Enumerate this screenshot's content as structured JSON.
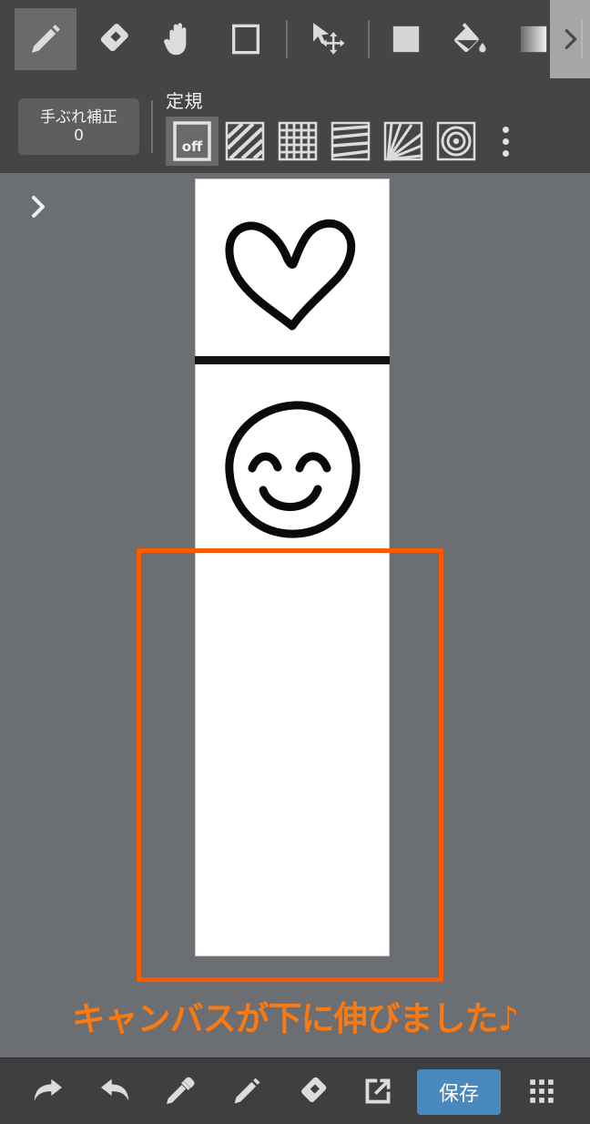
{
  "app": {
    "background_color": "#6b6e72",
    "toolbar_color": "#454545",
    "accent_color": "#fa5a00",
    "save_button_color": "#4a89bd"
  },
  "top_toolbar": {
    "tools": [
      {
        "name": "pencil-tool",
        "icon": "pencil-icon",
        "selected": true
      },
      {
        "name": "eraser-tool",
        "icon": "eraser-icon",
        "selected": false
      },
      {
        "name": "hand-tool",
        "icon": "hand-icon",
        "selected": false
      },
      {
        "name": "select-rect-tool",
        "icon": "rectangle-outline-icon",
        "selected": false
      },
      {
        "name": "move-transform-tool",
        "icon": "move-cursor-icon",
        "selected": false
      },
      {
        "name": "fill-color-tool",
        "icon": "filled-square-icon",
        "selected": false
      },
      {
        "name": "paint-bucket-tool",
        "icon": "paint-bucket-icon",
        "selected": false
      },
      {
        "name": "gradient-tool",
        "icon": "gradient-swatch-icon",
        "selected": false
      }
    ],
    "scroll_right": {
      "name": "scroll-right-button",
      "icon": "chevron-right-icon"
    }
  },
  "options_toolbar": {
    "stabilizer": {
      "label": "手ぶれ補正",
      "value": "0"
    },
    "ruler": {
      "label": "定規",
      "items": [
        {
          "name": "ruler-off",
          "icon": "ruler-off-icon",
          "label": "off",
          "selected": true
        },
        {
          "name": "ruler-parallel",
          "icon": "ruler-parallel-lines-icon",
          "selected": false
        },
        {
          "name": "ruler-grid",
          "icon": "ruler-grid-icon",
          "selected": false
        },
        {
          "name": "ruler-perspective",
          "icon": "ruler-perspective-icon",
          "selected": false
        },
        {
          "name": "ruler-radial",
          "icon": "ruler-radial-icon",
          "selected": false
        },
        {
          "name": "ruler-concentric",
          "icon": "ruler-concentric-circles-icon",
          "selected": false
        }
      ],
      "more_label": "more-options"
    }
  },
  "canvas": {
    "layer_panel_toggle_icon": "chevron-right-icon",
    "sheet_color": "#ffffff",
    "artwork": [
      {
        "name": "heart-drawing",
        "description": "hand-drawn heart outline"
      },
      {
        "name": "divider-line",
        "description": "thick black horizontal line"
      },
      {
        "name": "smiley-face-drawing",
        "description": "hand-drawn smiling face"
      }
    ],
    "selection_rect": {
      "name": "canvas-extend-selection",
      "color": "#fa5a00"
    },
    "message": "キャンバスが下に伸びました♪"
  },
  "bottom_toolbar": {
    "items": [
      {
        "name": "undo-button",
        "icon": "undo-arrow-icon"
      },
      {
        "name": "redo-button",
        "icon": "redo-arrow-icon"
      },
      {
        "name": "eyedropper-button",
        "icon": "eyedropper-icon"
      },
      {
        "name": "pencil-button",
        "icon": "pencil-icon"
      },
      {
        "name": "eraser-button",
        "icon": "eraser-icon"
      },
      {
        "name": "export-button",
        "icon": "export-external-link-icon"
      }
    ],
    "save_label": "保存",
    "menu": {
      "name": "app-grid-menu-button",
      "icon": "grid-dots-icon"
    }
  }
}
